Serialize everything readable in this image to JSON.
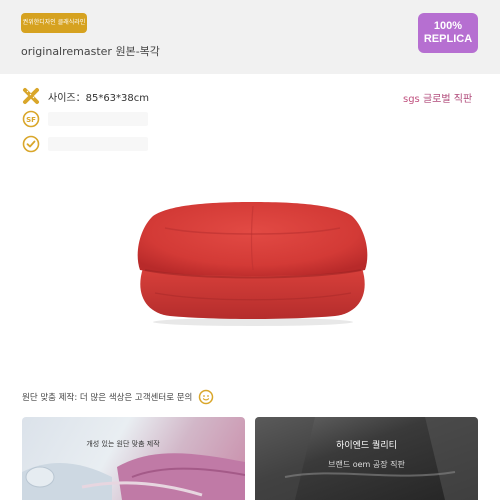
{
  "header": {
    "brand_badge": "권위한디자인 클래식라인",
    "subtitle": "originalremaster 원본-복각",
    "replica_line1": "100%",
    "replica_line2": "REPLICA"
  },
  "specs": {
    "size_label": "사이즈：85*63*38cm",
    "sgs_prefix": "sgs",
    "sgs_rest": " 글로벌 직판"
  },
  "note": {
    "text": "원단 맞춤 제작: 더 많은 색상은 고객센터로 문의"
  },
  "cards": [
    {
      "title": "개성 있는 원단 맞춤 제작",
      "subtitle": ""
    },
    {
      "title": "하이엔드 퀄리티",
      "subtitle": "브랜드 oem 공장 직판"
    }
  ],
  "colors": {
    "brand_gold": "#d6a220",
    "replica_purple": "#b66fd1",
    "sgs_pink": "#b04a7a",
    "product_red": "#d63a3a"
  },
  "icons": [
    "measure-x-icon",
    "sf-badge-icon",
    "check-badge-icon",
    "smile-icon"
  ]
}
